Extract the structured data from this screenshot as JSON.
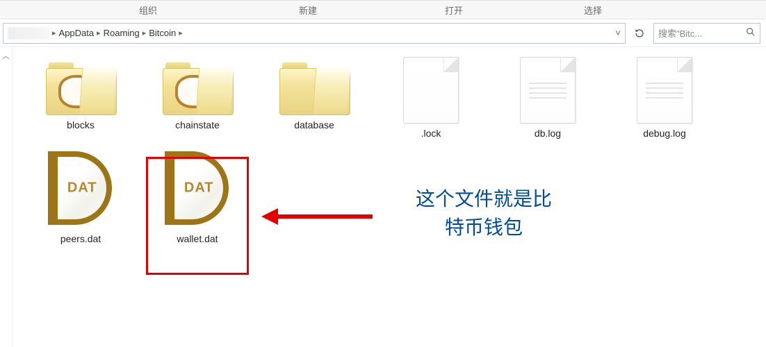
{
  "ribbon": {
    "groups": [
      "组织",
      "新建",
      "打开",
      "选择"
    ]
  },
  "breadcrumb": {
    "parts": [
      "AppData",
      "Roaming",
      "Bitcoin"
    ],
    "dropdown_more": "▸",
    "collapse": "˅"
  },
  "search": {
    "placeholder": "搜索\"Bitc..."
  },
  "items": [
    {
      "name": "blocks",
      "kind": "folder"
    },
    {
      "name": "chainstate",
      "kind": "folder"
    },
    {
      "name": "database",
      "kind": "folder"
    },
    {
      "name": ".lock",
      "kind": "txt"
    },
    {
      "name": "db.log",
      "kind": "txt"
    },
    {
      "name": "debug.log",
      "kind": "txt"
    },
    {
      "name": "peers.dat",
      "kind": "dat"
    },
    {
      "name": "wallet.dat",
      "kind": "dat",
      "highlighted": true
    }
  ],
  "dat_badge_text": "DAT",
  "annotation": {
    "line1": "这个文件就是比",
    "line2": "特币钱包"
  }
}
